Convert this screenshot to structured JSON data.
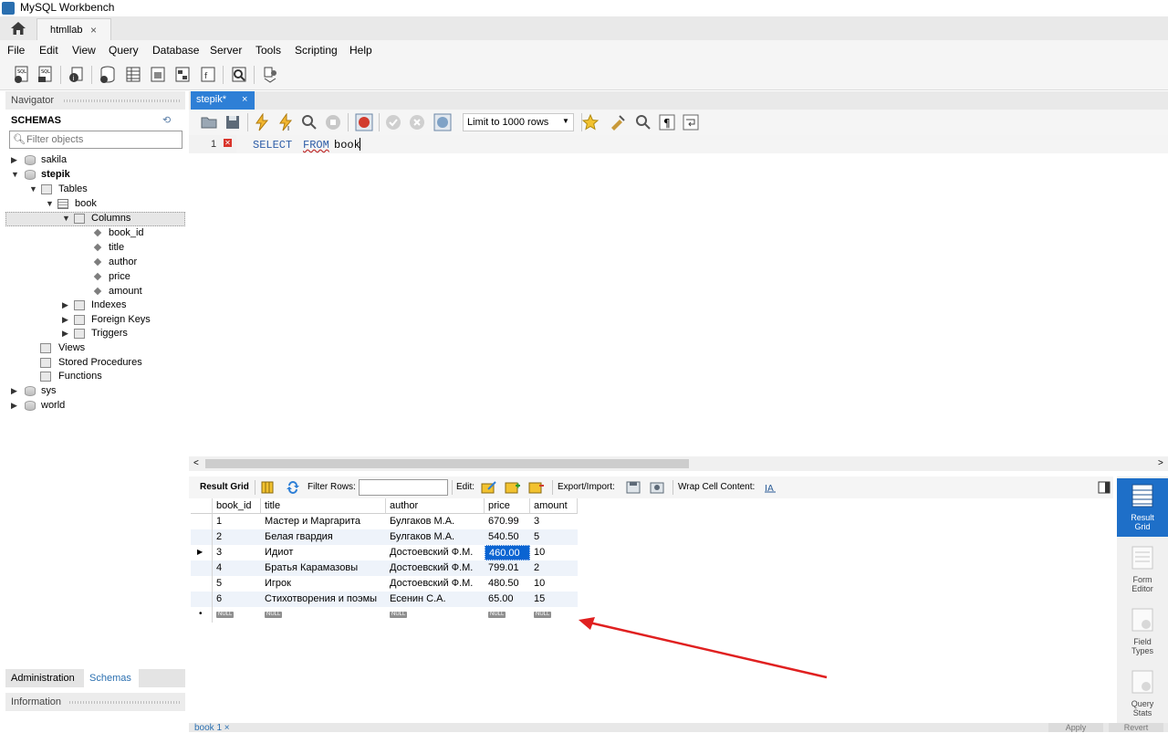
{
  "window": {
    "title": "MySQL Workbench"
  },
  "conn_tab": {
    "label": "htmllab",
    "close": "×"
  },
  "menu": [
    "File",
    "Edit",
    "View",
    "Query",
    "Database",
    "Server",
    "Tools",
    "Scripting",
    "Help"
  ],
  "navigator": {
    "header": "Navigator",
    "schemas_label": "SCHEMAS",
    "filter_placeholder": "Filter objects",
    "tree": {
      "sakila": "sakila",
      "stepik": "stepik",
      "tables": "Tables",
      "book": "book",
      "columns": "Columns",
      "col_book_id": "book_id",
      "col_title": "title",
      "col_author": "author",
      "col_price": "price",
      "col_amount": "amount",
      "indexes": "Indexes",
      "foreign_keys": "Foreign Keys",
      "triggers": "Triggers",
      "views": "Views",
      "stored_procedures": "Stored Procedures",
      "functions": "Functions",
      "sys": "sys",
      "world": "world"
    },
    "tabs": {
      "administration": "Administration",
      "schemas": "Schemas"
    },
    "information": "Information"
  },
  "editor": {
    "tab_label": "stepik*",
    "tab_close": "×",
    "limit_label": "Limit to 1000 rows",
    "line_number": "1",
    "sql": {
      "kw1": "SELECT",
      "kw2": "FROM",
      "ident": "book"
    }
  },
  "result_toolbar": {
    "result_grid": "Result Grid",
    "filter_rows": "Filter Rows:",
    "edit": "Edit:",
    "export_import": "Export/Import:",
    "wrap": "Wrap Cell Content:"
  },
  "grid": {
    "columns": [
      "book_id",
      "title",
      "author",
      "price",
      "amount"
    ],
    "rows": [
      [
        "1",
        "Мастер и Маргарита",
        "Булгаков М.А.",
        "670.99",
        "3"
      ],
      [
        "2",
        "Белая гвардия",
        "Булгаков М.А.",
        "540.50",
        "5"
      ],
      [
        "3",
        "Идиот",
        "Достоевский Ф.М.",
        "460.00",
        "10"
      ],
      [
        "4",
        "Братья Карамазовы",
        "Достоевский Ф.М.",
        "799.01",
        "2"
      ],
      [
        "5",
        "Игрок",
        "Достоевский Ф.М.",
        "480.50",
        "10"
      ],
      [
        "6",
        "Стихотворения и поэмы",
        "Есенин С.А.",
        "65.00",
        "15"
      ]
    ],
    "null_label": "NULL",
    "selected_row": 2,
    "selected_col": 3,
    "selection_color": "#0a64d2"
  },
  "side_panel": {
    "result_grid": [
      "Result",
      "Grid"
    ],
    "form_editor": [
      "Form",
      "Editor"
    ],
    "field_types": [
      "Field",
      "Types"
    ],
    "query_stats": [
      "Query",
      "Stats"
    ],
    "active_color": "#1e6fc8"
  },
  "bottom": {
    "tab": "book 1 ×",
    "apply": "Apply",
    "revert": "Revert"
  },
  "annotation_color": "#e02020"
}
